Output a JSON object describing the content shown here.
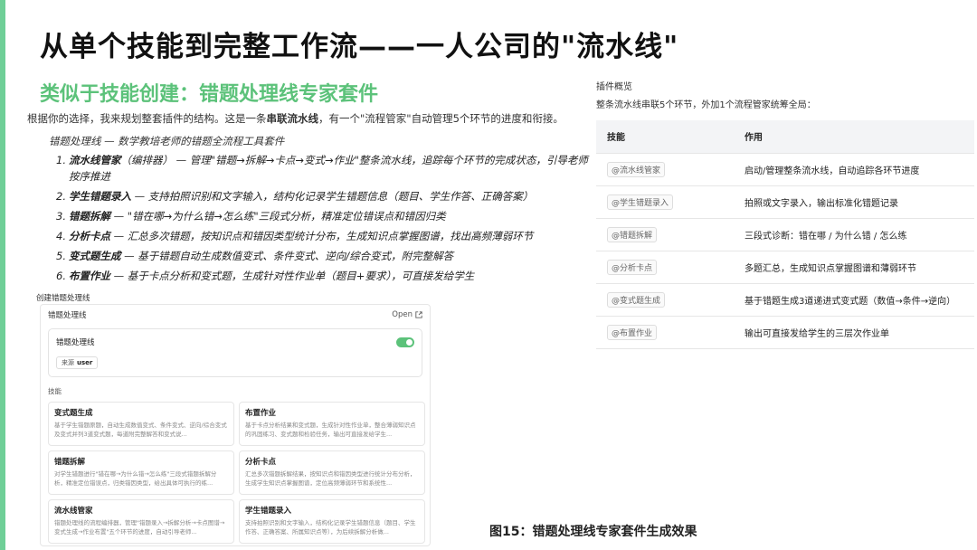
{
  "slide": {
    "title": "从单个技能到完整工作流——一人公司的\"流水线\"",
    "subtitle": "类似于技能创建：错题处理线专家套件",
    "intro_prefix": "根据你的选择，我来规划整套插件的结构。这是一条",
    "intro_bold": "串联流水线",
    "intro_suffix": "，有一个\"流程管家\"自动管理5个环节的进度和衔接。",
    "heading_line": "错题处理线 — 数学教培老师的错题全流程工具套件",
    "steps": [
      {
        "num": "1.",
        "name": "流水线管家",
        "desc": "（编排器） — 管理\"错题→拆解→卡点→变式→作业\"整条流水线，追踪每个环节的完成状态，引导老师按序推进"
      },
      {
        "num": "2.",
        "name": "学生错题录入",
        "desc": " — 支持拍照识别和文字输入，结构化记录学生错题信息（题目、学生作答、正确答案）"
      },
      {
        "num": "3.",
        "name": "错题拆解",
        "desc": " — \"错在哪→为什么错→怎么练\"三段式分析，精准定位错误点和错因归类"
      },
      {
        "num": "4.",
        "name": "分析卡点",
        "desc": " — 汇总多次错题，按知识点和错因类型统计分布，生成知识点掌握图谱，找出高频薄弱环节"
      },
      {
        "num": "5.",
        "name": "变式题生成",
        "desc": " — 基于错题自动生成数值变式、条件变式、逆向/综合变式，附完整解答"
      },
      {
        "num": "6.",
        "name": "布置作业",
        "desc": " — 基于卡点分析和变式题，生成针对性作业单（题目+要求），可直接发给学生"
      }
    ],
    "figure_caption": "图15：错题处理线专家套件生成效果"
  },
  "panel": {
    "caption": "创建错题处理线",
    "title": "错题处理线",
    "open_label": "Open",
    "card_name": "错题处理线",
    "source_label": "来源",
    "source_value": "user",
    "toggle_on": true,
    "skills_label": "技能",
    "skills": [
      {
        "name": "变式题生成",
        "desc": "基于学生错题原题，自动生成数值变式、条件变式、逆向/综合变式及变式并列3道变式题，每道附完整解答和变式说..."
      },
      {
        "name": "布置作业",
        "desc": "基于卡点分析结果和变式题，生成针对性作业单，整合薄弱知识点的巩固练习、变式题和检验任务，输出可直接发给学生..."
      },
      {
        "name": "错题拆解",
        "desc": "对学生错题进行\"错在哪→为什么错→怎么练\"三段式错题拆解分析，精准定位错误点，归类错因类型，给出具体可执行的练..."
      },
      {
        "name": "分析卡点",
        "desc": "汇总多次错题拆解结果，按知识点和错因类型进行统计分布分析，生成学生知识点掌握图谱，定位高频薄弱环节和系统性..."
      },
      {
        "name": "流水线管家",
        "desc": "错题处理线的流程编排器，管理\"错题录入→拆解分析→卡点图谱→变式生成→作业布置\"五个环节的进度，自动引导老师..."
      },
      {
        "name": "学生错题录入",
        "desc": "支持拍照识别和文字输入，结构化记录学生错题信息（题目、学生作答、正确答案、所属知识点等），为后续拆解分析做..."
      }
    ]
  },
  "overview": {
    "title": "插件概览",
    "subtitle": "整条流水线串联5个环节，外加1个流程管家统筹全局：",
    "columns": [
      "技能",
      "作用"
    ],
    "rows": [
      {
        "skill": "@流水线管家",
        "role": "启动/管理整条流水线，自动追踪各环节进度"
      },
      {
        "skill": "@学生错题录入",
        "role": "拍照或文字录入，输出标准化错题记录"
      },
      {
        "skill": "@错题拆解",
        "role": "三段式诊断：错在哪 / 为什么错 / 怎么练"
      },
      {
        "skill": "@分析卡点",
        "role": "多题汇总，生成知识点掌握图谱和薄弱环节"
      },
      {
        "skill": "@变式题生成",
        "role": "基于错题生成3道递进式变式题（数值→条件→逆向）"
      },
      {
        "skill": "@布置作业",
        "role": "输出可直接发给学生的三层次作业单"
      }
    ]
  },
  "colors": {
    "accent": "#5cc27a",
    "accent_bar": "#6fcf97",
    "table_header_bg": "#f3f4f6"
  }
}
